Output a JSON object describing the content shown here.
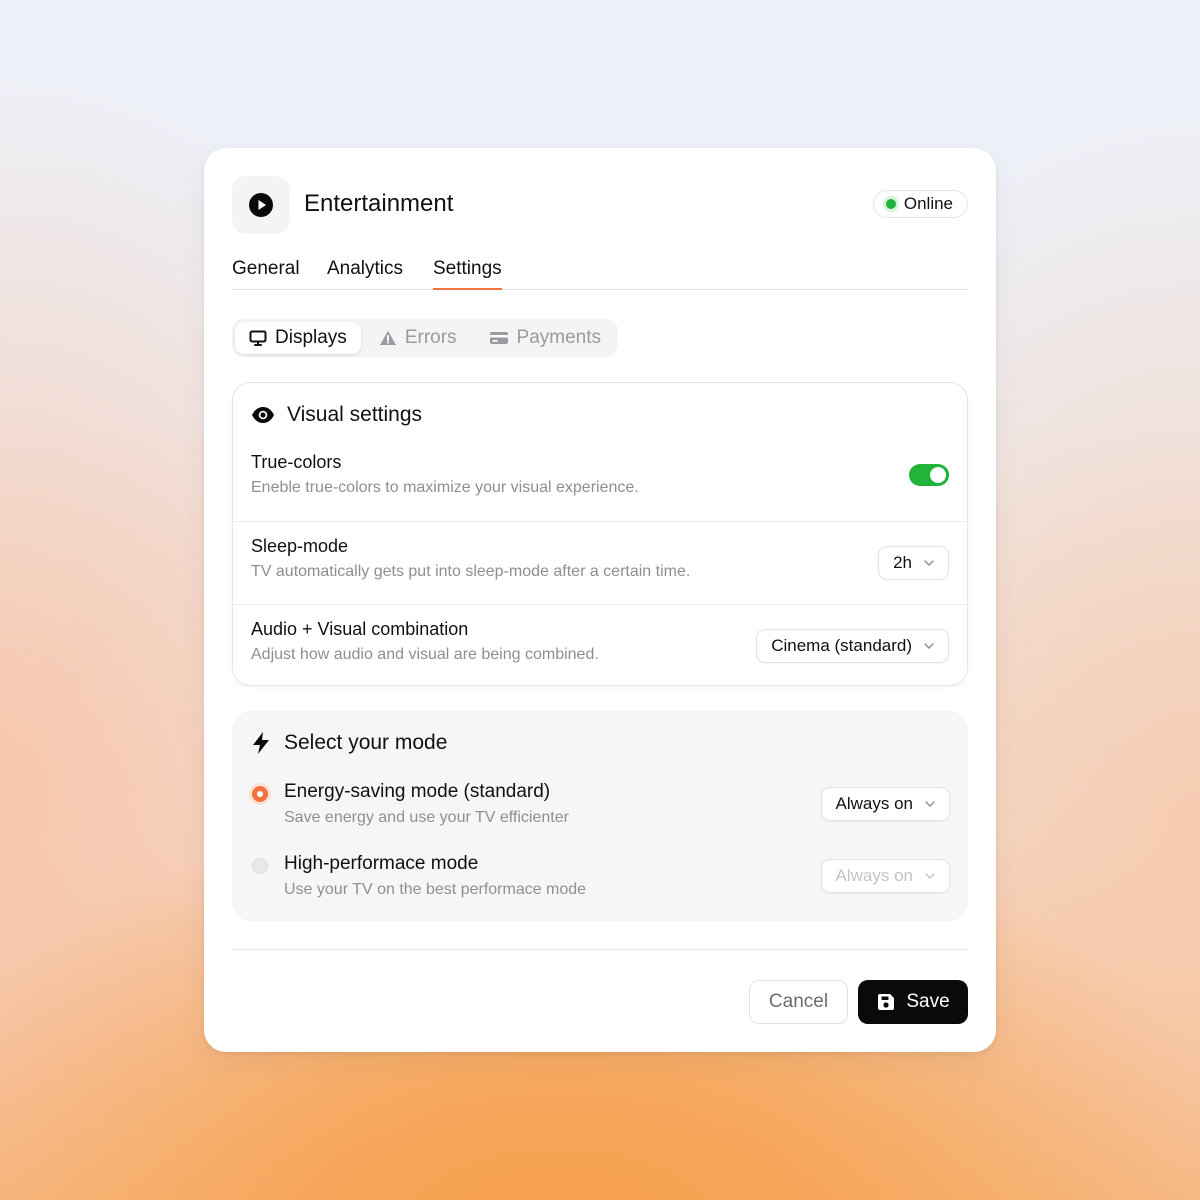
{
  "app": {
    "title": "Entertainment",
    "status": "Online"
  },
  "tabs": [
    {
      "label": "General"
    },
    {
      "label": "Analytics"
    },
    {
      "label": "Settings",
      "active": true
    }
  ],
  "segments": [
    {
      "label": "Displays",
      "icon": "monitor-icon",
      "active": true
    },
    {
      "label": "Errors",
      "icon": "warning-icon"
    },
    {
      "label": "Payments",
      "icon": "credit-card-icon"
    }
  ],
  "visual_settings": {
    "title": "Visual settings",
    "rows": [
      {
        "title": "True-colors",
        "description": "Eneble true-colors to maximize your visual experience.",
        "toggle_on": true
      },
      {
        "title": "Sleep-mode",
        "description": "TV automatically gets put into sleep-mode after a certain time.",
        "value": "2h"
      },
      {
        "title": "Audio + Visual combination",
        "description": "Adjust how audio and visual are being combined.",
        "value": "Cinema (standard)"
      }
    ]
  },
  "mode": {
    "title": "Select your mode",
    "options": [
      {
        "title": "Energy-saving mode (standard)",
        "description": "Save energy and use your TV efficienter",
        "value": "Always on",
        "selected": true
      },
      {
        "title": "High-performace mode",
        "description": "Use your TV on the best performace mode",
        "value": "Always on",
        "selected": false
      }
    ]
  },
  "footer": {
    "cancel_label": "Cancel",
    "save_label": "Save"
  },
  "colors": {
    "accent": "#f2733b",
    "online": "#22b33a",
    "primary_button": "#0a0a0a"
  }
}
